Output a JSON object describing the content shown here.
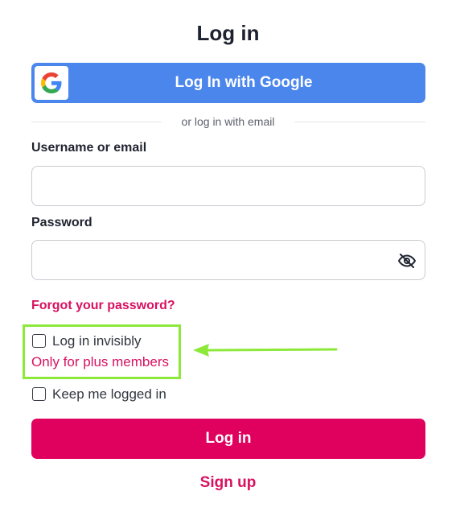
{
  "page": {
    "title": "Log in"
  },
  "google_button": {
    "label": "Log In with Google",
    "icon": "google-logo-icon",
    "color": "#4b86ec"
  },
  "divider": {
    "text": "or log in with email"
  },
  "username": {
    "label": "Username or email",
    "value": "",
    "placeholder": ""
  },
  "password": {
    "label": "Password",
    "value": "",
    "placeholder": "",
    "toggle_icon": "eye-slash-icon"
  },
  "forgot_password": {
    "label": "Forgot your password?"
  },
  "invisible_login": {
    "label": "Log in invisibly",
    "checked": false,
    "note": "Only for plus members",
    "highlight_color": "#8ce93a"
  },
  "keep_logged_in": {
    "label": "Keep me logged in",
    "checked": false
  },
  "submit": {
    "label": "Log in",
    "color": "#e0005e"
  },
  "signup": {
    "label": "Sign up"
  },
  "colors": {
    "accent_pink": "#d81160",
    "annotation_green": "#8ce93a"
  }
}
